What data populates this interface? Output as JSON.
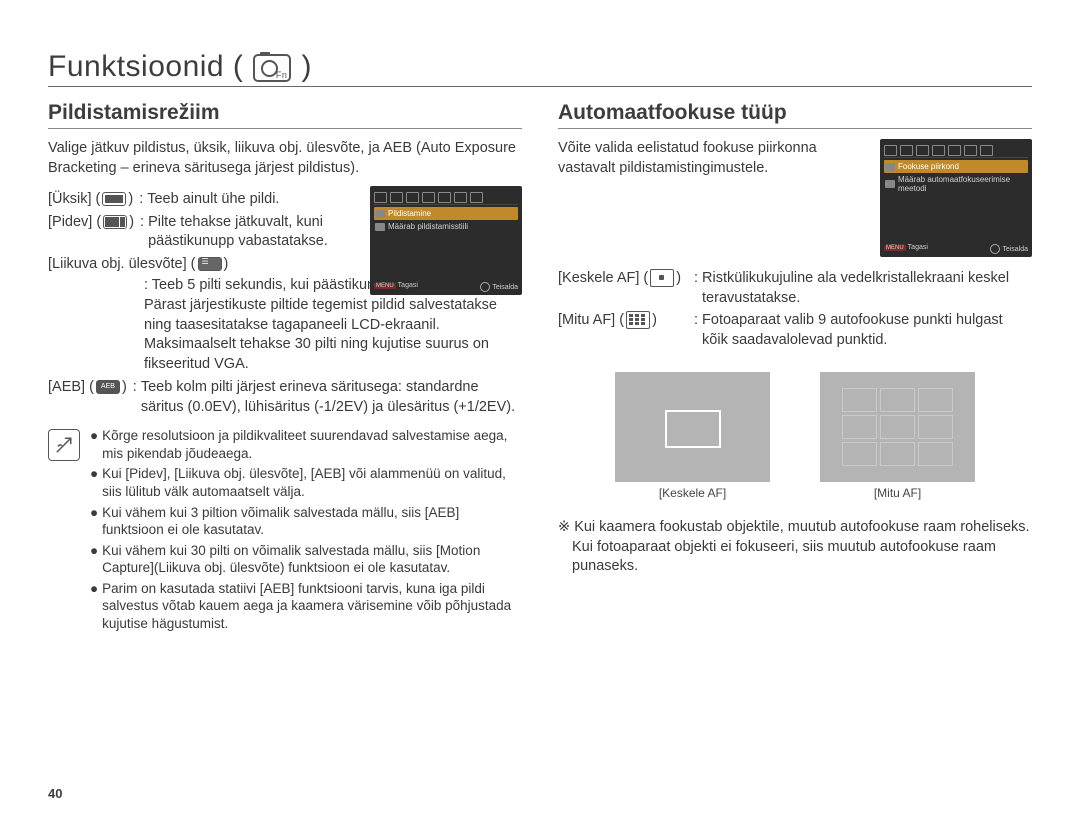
{
  "chapter": {
    "title": "Funktsioonid (",
    "title_close": ")"
  },
  "page_number": "40",
  "left": {
    "subtitle": "Pildistamisrežiim",
    "intro": "Valige jätkuv pildistus, üksik, liikuva obj. ülesvõte, ja AEB (Auto Exposure Bracketing – erineva säritusega järjest pildistus).",
    "items": {
      "uksik": {
        "label": "[Üksik] (",
        "close": ") ",
        "desc": "Teeb ainult ühe pildi."
      },
      "pidev": {
        "label": "[Pidev] (",
        "close": ") ",
        "desc": "Pilte tehakse jätkuvalt, kuni päästikunupp vabastatakse."
      },
      "liikuva": {
        "label": "[Liikuva obj. ülesvõte] (",
        "close": ")",
        "desc": "Teeb 5 pilti sekundis, kui päästikunuppu all hoitakse. Pärast järjestikuste piltide tegemist pildid salvestatakse ning taasesitatakse tagapaneeli LCD-ekraanil. Maksimaalselt tehakse 30 pilti ning kujutise suurus on fikseeritud VGA."
      },
      "aeb": {
        "label": "[AEB] (",
        "close": ") ",
        "aeb_text": "AEB",
        "desc": "Teeb kolm pilti järjest erineva säritusega: standardne säritus (0.0EV), lühisäritus (-1/2EV) ja ülesäritus (+1/2EV)."
      }
    },
    "notes": [
      "Kõrge resolutsioon ja pildikvaliteet suurendavad salvestamise aega, mis pikendab jõudeaega.",
      "Kui [Pidev], [Liikuva obj. ülesvõte], [AEB] või alammenüü on valitud, siis lülitub välk automaatselt välja.",
      "Kui vähem kui 3 piltion võimalik salvestada mällu, siis [AEB] funktsioon ei ole kasutatav.",
      "Kui vähem kui 30 pilti on võimalik salvestada mällu, siis [Motion Capture](Liikuva obj. ülesvõte) funktsioon ei ole kasutatav.",
      "Parim on kasutada statiivi [AEB] funktsiooni tarvis, kuna iga pildi salvestus võtab kauem aega ja kaamera värisemine võib põhjustada kujutise hägustumist."
    ],
    "shot": {
      "row1": "Pildistamine",
      "row2": "Määrab pildistamisstiili",
      "back_label": "MENU",
      "back_text": "Tagasi",
      "move_text": "Teisalda"
    }
  },
  "right": {
    "subtitle": "Automaatfookuse tüüp",
    "intro": "Võite valida eelistatud fookuse piirkonna vastavalt pildistamistingimustele.",
    "center": {
      "label": "[Keskele AF] (",
      "close": ") ",
      "desc": "Ristkülikukujuline ala vedelkristallekraani keskel teravustatakse."
    },
    "multi": {
      "label": "[Mitu AF] (",
      "close": ") ",
      "desc": "Fotoaparaat valib 9 autofookuse punkti hulgast kõik saadavalolevad punktid."
    },
    "cap_center": "[Keskele AF]",
    "cap_multi": "[Mitu AF]",
    "footnote": "Kui kaamera fookustab objektile, muutub autofookuse raam roheliseks. Kui fotoaparaat objekti ei fokuseeri, siis muutub autofookuse raam punaseks.",
    "foot_marker": "※ ",
    "shot": {
      "row1": "Fookuse piirkond",
      "row2": "Määrab automaatfokuseerimise meetodi",
      "back_label": "MENU",
      "back_text": "Tagasi",
      "move_text": "Teisalda"
    }
  }
}
